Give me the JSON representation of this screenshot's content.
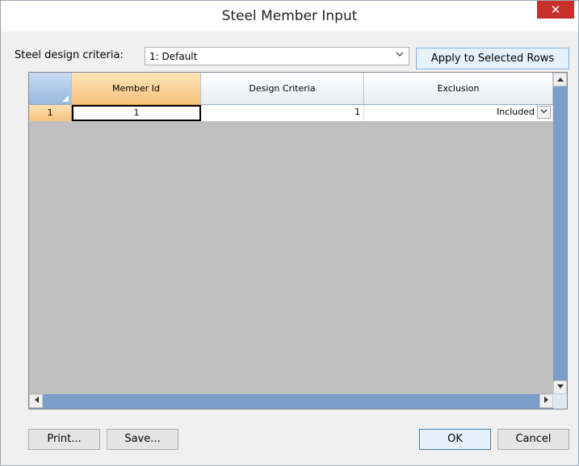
{
  "window": {
    "title": "Steel Member Input",
    "close_glyph": "✕"
  },
  "criteria": {
    "label": "Steel design criteria:",
    "selected": "1: Default",
    "apply_label": "Apply to Selected Rows"
  },
  "grid": {
    "columns": [
      "Member Id",
      "Design Criteria",
      "Exclusion"
    ],
    "rows": [
      {
        "row_number": "1",
        "member_id": "1",
        "design_criteria": "1",
        "exclusion": "Included"
      }
    ]
  },
  "buttons": {
    "print": "Print...",
    "save": "Save...",
    "ok": "OK",
    "cancel": "Cancel"
  },
  "icons": {
    "close": "close-icon",
    "dropdown": "chevron-down-icon",
    "scroll_up": "arrow-up-icon",
    "scroll_down": "arrow-down-icon",
    "scroll_left": "arrow-left-icon",
    "scroll_right": "arrow-right-icon"
  },
  "colors": {
    "close_button": "#c7302b",
    "active_header": "#f7c37b",
    "scrollbar": "#7b9fc9",
    "grid_background": "#c0c0c0"
  }
}
